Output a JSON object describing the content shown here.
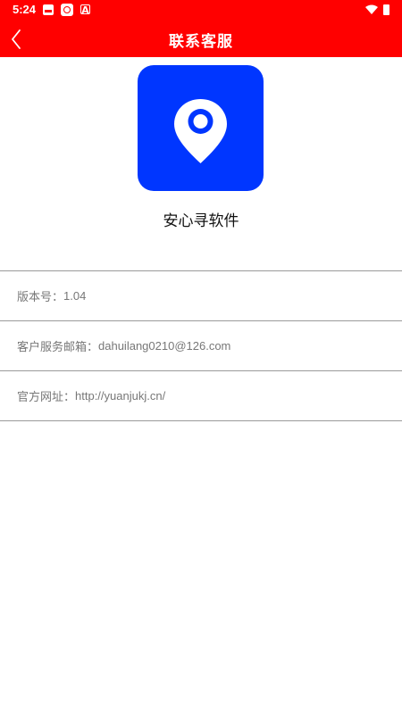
{
  "status_bar": {
    "time": "5:24",
    "a_icon_glyph": "A"
  },
  "header": {
    "title": "联系客服",
    "back_icon": "chevron-left-icon"
  },
  "app": {
    "name": "安心寻软件",
    "logo_icon": "location-pin-icon"
  },
  "info": {
    "version_label": "版本号：",
    "version_value": "1.04",
    "email_label": "客户服务邮箱：",
    "email_value": "dahuilang0210@126.com",
    "website_label": "官方网址：",
    "website_value": "http://yuanjukj.cn/"
  },
  "colors": {
    "header_bg": "#ff0000",
    "logo_bg": "#0036ff",
    "divider": "#9a9a9a",
    "info_text": "#777777"
  }
}
